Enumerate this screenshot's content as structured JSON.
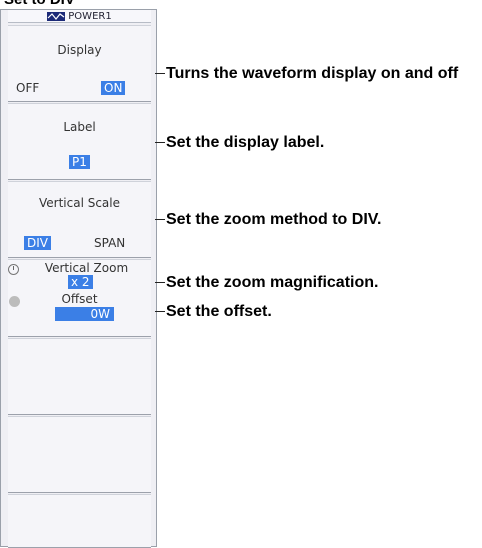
{
  "caption": "Set to DIV",
  "header": {
    "title": "POWER1"
  },
  "display": {
    "title": "Display",
    "off": "OFF",
    "on": "ON"
  },
  "label": {
    "title": "Label",
    "value": "P1"
  },
  "vertical_scale": {
    "title": "Vertical Scale",
    "div": "DIV",
    "span": "SPAN"
  },
  "vertical_zoom": {
    "title": "Vertical Zoom",
    "value": "x 2"
  },
  "offset": {
    "title": "Offset",
    "value": "0W"
  },
  "annotations": {
    "display": "Turns the waveform display on and off",
    "label": "Set the display label.",
    "scale": "Set the zoom method to DIV.",
    "zoom": "Set the zoom magnification.",
    "offset": "Set the offset."
  }
}
